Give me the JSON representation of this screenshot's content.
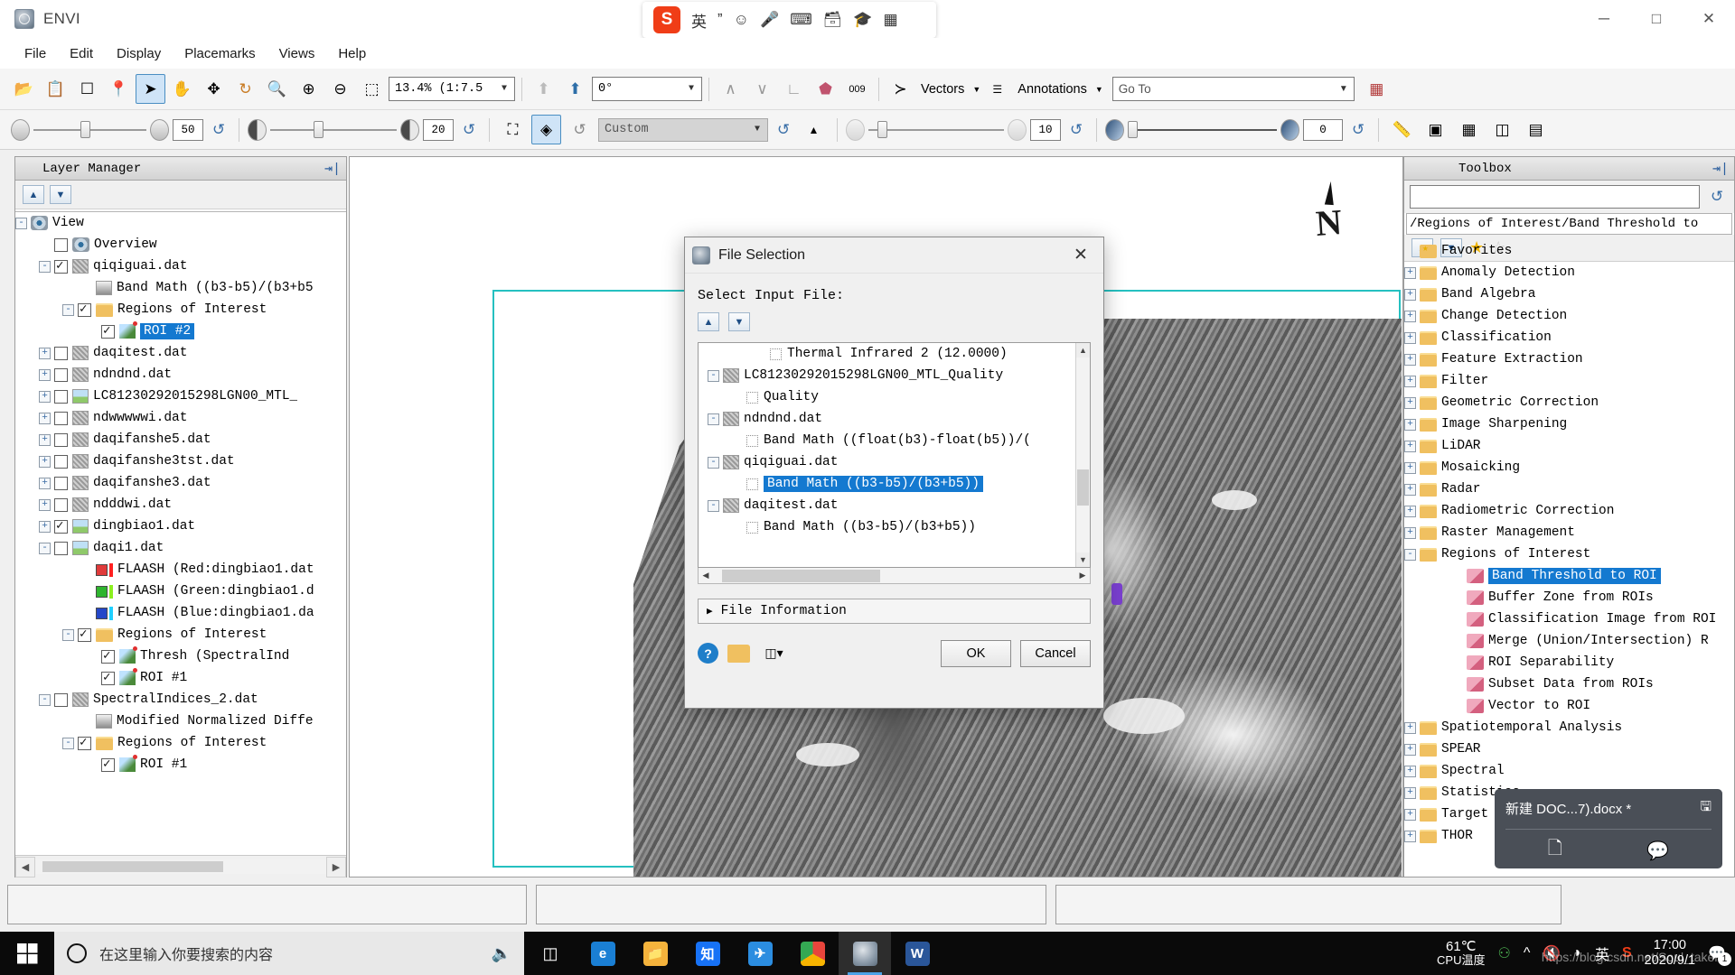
{
  "app": {
    "title": "ENVI",
    "icon": "envi-logo-icon"
  },
  "window_controls": {
    "minimize": "─",
    "maximize": "□",
    "close": "✕"
  },
  "ime": {
    "logo": "S",
    "items": [
      "英",
      "ˮ",
      "☺",
      "mic-icon",
      "keyboard-icon",
      "card-icon",
      "hat-icon",
      "grid-icon"
    ]
  },
  "menu": [
    "File",
    "Edit",
    "Display",
    "Placemarks",
    "Views",
    "Help"
  ],
  "toolbar1": {
    "buttons": [
      {
        "name": "open-file-icon",
        "glyph": "📂"
      },
      {
        "name": "clipboard-icon",
        "glyph": "📋"
      },
      {
        "name": "crop-icon",
        "glyph": "❐"
      },
      {
        "name": "placemark-pin-icon",
        "glyph": "📍"
      },
      {
        "name": "select-cursor-icon",
        "glyph": "➤"
      },
      {
        "name": "pan-hand-icon",
        "glyph": "✋"
      },
      {
        "name": "move-icon",
        "glyph": "✥"
      },
      {
        "name": "rotate-icon",
        "glyph": "↻"
      },
      {
        "name": "zoom-fit-icon",
        "glyph": "🔍"
      },
      {
        "name": "zoom-in-icon",
        "glyph": "⊕"
      },
      {
        "name": "zoom-out-icon",
        "glyph": "⊖"
      },
      {
        "name": "zoom-to-region-icon",
        "glyph": "⬚"
      }
    ],
    "zoom_value": "13.4% (1:7.5",
    "rotation_value": "0°",
    "arrow_up_icons": [
      "arrow-up-gray-icon",
      "arrow-up-north-icon"
    ],
    "extra_icons": [
      {
        "name": "spectral-profile-icon",
        "glyph": "ᴡ"
      },
      {
        "name": "spectral-library-icon",
        "glyph": "ᴡ"
      },
      {
        "name": "cursor-value-icon",
        "glyph": "∠"
      },
      {
        "name": "roi-tool-icon",
        "glyph": "⬟"
      },
      {
        "name": "pixel-locator-icon",
        "glyph": "009"
      }
    ],
    "vectors_label": "Vectors",
    "annotations_label": "Annotations",
    "goto_placeholder": "Go To",
    "goto_value": "Go To",
    "last_icon": "data-manager-icon"
  },
  "toolbar2": {
    "brightness_value": "50",
    "contrast_value": "20",
    "stretch_value": "Custom",
    "sharpen_value": "10",
    "transparency_value": "0",
    "fit_icons": [
      "fit-to-window-icon",
      "zoom-to-extent-icon"
    ]
  },
  "layer_manager": {
    "title": "Layer Manager",
    "pin_icon": "pin-panel-icon",
    "tools": [
      "move-layer-up-icon",
      "move-layer-down-icon"
    ],
    "tree": [
      {
        "indent": 0,
        "expander": "-",
        "checkbox": "none",
        "icon": "eye",
        "label": "View"
      },
      {
        "indent": 1,
        "expander": "none",
        "checkbox": "off",
        "icon": "eye",
        "label": "Overview"
      },
      {
        "indent": 1,
        "expander": "-",
        "checkbox": "on",
        "icon": "raster",
        "label": "qiqiguai.dat"
      },
      {
        "indent": 2,
        "expander": "none",
        "checkbox": "hidden",
        "icon": "band",
        "label": "Band Math ((b3-b5)/(b3+b5"
      },
      {
        "indent": 2,
        "expander": "-",
        "checkbox": "on",
        "icon": "folder",
        "label": "Regions of Interest"
      },
      {
        "indent": 3,
        "expander": "none",
        "checkbox": "on",
        "icon": "roi",
        "label": "ROI #2",
        "selected": true
      },
      {
        "indent": 1,
        "expander": "+",
        "checkbox": "off",
        "icon": "raster",
        "label": "daqitest.dat"
      },
      {
        "indent": 1,
        "expander": "+",
        "checkbox": "off",
        "icon": "raster",
        "label": "ndndnd.dat"
      },
      {
        "indent": 1,
        "expander": "+",
        "checkbox": "off",
        "icon": "img",
        "label": "LC81230292015298LGN00_MTL_"
      },
      {
        "indent": 1,
        "expander": "+",
        "checkbox": "off",
        "icon": "raster",
        "label": "ndwwwwwi.dat"
      },
      {
        "indent": 1,
        "expander": "+",
        "checkbox": "off",
        "icon": "raster",
        "label": "daqifanshe5.dat"
      },
      {
        "indent": 1,
        "expander": "+",
        "checkbox": "off",
        "icon": "raster",
        "label": "daqifanshe3tst.dat"
      },
      {
        "indent": 1,
        "expander": "+",
        "checkbox": "off",
        "icon": "raster",
        "label": "daqifanshe3.dat"
      },
      {
        "indent": 1,
        "expander": "+",
        "checkbox": "off",
        "icon": "raster",
        "label": "ndddwi.dat"
      },
      {
        "indent": 1,
        "expander": "+",
        "checkbox": "on",
        "icon": "img",
        "label": "dingbiao1.dat"
      },
      {
        "indent": 1,
        "expander": "-",
        "checkbox": "off",
        "icon": "img",
        "label": "daqi1.dat"
      },
      {
        "indent": 2,
        "expander": "none",
        "checkbox": "hidden",
        "icon": "swatch-red",
        "label": "FLAASH (Red:dingbiao1.dat"
      },
      {
        "indent": 2,
        "expander": "none",
        "checkbox": "hidden",
        "icon": "swatch-green",
        "label": "FLAASH (Green:dingbiao1.d"
      },
      {
        "indent": 2,
        "expander": "none",
        "checkbox": "hidden",
        "icon": "swatch-blue",
        "label": "FLAASH (Blue:dingbiao1.da"
      },
      {
        "indent": 2,
        "expander": "-",
        "checkbox": "on",
        "icon": "folder",
        "label": "Regions of Interest"
      },
      {
        "indent": 3,
        "expander": "none",
        "checkbox": "on",
        "icon": "roi",
        "label": "Thresh (SpectralInd"
      },
      {
        "indent": 3,
        "expander": "none",
        "checkbox": "on",
        "icon": "roi",
        "label": "ROI #1"
      },
      {
        "indent": 1,
        "expander": "-",
        "checkbox": "off",
        "icon": "raster",
        "label": "SpectralIndices_2.dat"
      },
      {
        "indent": 2,
        "expander": "none",
        "checkbox": "hidden",
        "icon": "band",
        "label": "Modified Normalized Diffe"
      },
      {
        "indent": 2,
        "expander": "-",
        "checkbox": "on",
        "icon": "folder",
        "label": "Regions of Interest"
      },
      {
        "indent": 3,
        "expander": "none",
        "checkbox": "on",
        "icon": "roi",
        "label": "ROI #1"
      }
    ]
  },
  "toolbox": {
    "title": "Toolbox",
    "pin_icon": "pin-panel-icon",
    "search_value": "",
    "refresh_icon": "refresh-icon",
    "path": "/Regions of Interest/Band Threshold to",
    "tools": [
      "move-up-icon",
      "move-down-icon",
      "add-favorite-star-icon",
      "remove-favorite-star-icon"
    ],
    "tree": [
      {
        "indent": 0,
        "expander": "none",
        "icon": "fav",
        "label": "Favorites"
      },
      {
        "indent": 0,
        "expander": "+",
        "icon": "folder",
        "label": "Anomaly Detection"
      },
      {
        "indent": 0,
        "expander": "+",
        "icon": "folder",
        "label": "Band Algebra"
      },
      {
        "indent": 0,
        "expander": "+",
        "icon": "folder",
        "label": "Change Detection"
      },
      {
        "indent": 0,
        "expander": "+",
        "icon": "folder",
        "label": "Classification"
      },
      {
        "indent": 0,
        "expander": "+",
        "icon": "folder",
        "label": "Feature Extraction"
      },
      {
        "indent": 0,
        "expander": "+",
        "icon": "folder",
        "label": "Filter"
      },
      {
        "indent": 0,
        "expander": "+",
        "icon": "folder",
        "label": "Geometric Correction"
      },
      {
        "indent": 0,
        "expander": "+",
        "icon": "folder",
        "label": "Image Sharpening"
      },
      {
        "indent": 0,
        "expander": "+",
        "icon": "folder",
        "label": "LiDAR"
      },
      {
        "indent": 0,
        "expander": "+",
        "icon": "folder",
        "label": "Mosaicking"
      },
      {
        "indent": 0,
        "expander": "+",
        "icon": "folder",
        "label": "Radar"
      },
      {
        "indent": 0,
        "expander": "+",
        "icon": "folder",
        "label": "Radiometric Correction"
      },
      {
        "indent": 0,
        "expander": "+",
        "icon": "folder",
        "label": "Raster Management"
      },
      {
        "indent": 0,
        "expander": "-",
        "icon": "folder",
        "label": "Regions of Interest"
      },
      {
        "indent": 1,
        "expander": "none",
        "icon": "roitool",
        "label": "Band Threshold to ROI",
        "selected": true
      },
      {
        "indent": 1,
        "expander": "none",
        "icon": "roitool",
        "label": "Buffer Zone from ROIs"
      },
      {
        "indent": 1,
        "expander": "none",
        "icon": "roitool",
        "label": "Classification Image from ROI"
      },
      {
        "indent": 1,
        "expander": "none",
        "icon": "roitool",
        "label": "Merge (Union/Intersection) R"
      },
      {
        "indent": 1,
        "expander": "none",
        "icon": "roitool",
        "label": "ROI Separability"
      },
      {
        "indent": 1,
        "expander": "none",
        "icon": "roitool",
        "label": "Subset Data from ROIs"
      },
      {
        "indent": 1,
        "expander": "none",
        "icon": "roitool",
        "label": "Vector to ROI"
      },
      {
        "indent": 0,
        "expander": "+",
        "icon": "folder",
        "label": "Spatiotemporal Analysis"
      },
      {
        "indent": 0,
        "expander": "+",
        "icon": "folder",
        "label": "SPEAR"
      },
      {
        "indent": 0,
        "expander": "+",
        "icon": "folder",
        "label": "Spectral"
      },
      {
        "indent": 0,
        "expander": "+",
        "icon": "folder",
        "label": "Statistics"
      },
      {
        "indent": 0,
        "expander": "+",
        "icon": "folder",
        "label": "Target Detection"
      },
      {
        "indent": 0,
        "expander": "+",
        "icon": "folder",
        "label": "THOR"
      }
    ]
  },
  "dialog": {
    "title": "File Selection",
    "icon": "envi-logo-icon",
    "close_icon": "close-icon",
    "subtitle": "Select Input File:",
    "nav_buttons": [
      "move-up-icon",
      "move-down-icon"
    ],
    "list": [
      {
        "indent": 2,
        "expander": "none",
        "label": "Thermal Infrared 2 (12.0000)"
      },
      {
        "indent": 0,
        "expander": "-",
        "icon": "raster",
        "label": "LC81230292015298LGN00_MTL_Quality"
      },
      {
        "indent": 1,
        "expander": "none",
        "label": "Quality"
      },
      {
        "indent": 0,
        "expander": "-",
        "icon": "raster",
        "label": "ndndnd.dat"
      },
      {
        "indent": 1,
        "expander": "none",
        "label": "Band Math ((float(b3)-float(b5))/("
      },
      {
        "indent": 0,
        "expander": "-",
        "icon": "raster",
        "label": "qiqiguai.dat"
      },
      {
        "indent": 1,
        "expander": "none",
        "label": "Band Math ((b3-b5)/(b3+b5))",
        "selected": true
      },
      {
        "indent": 0,
        "expander": "-",
        "icon": "raster",
        "label": "daqitest.dat"
      },
      {
        "indent": 1,
        "expander": "none",
        "label": "Band Math ((b3-b5)/(b3+b5))"
      }
    ],
    "file_information": "File Information",
    "file_information_expander": "▶",
    "help_icon": "help-icon",
    "open_icon": "open-folder-icon",
    "filter_icon": "filter-icon",
    "ok_label": "OK",
    "cancel_label": "Cancel"
  },
  "view": {
    "north_label": "N",
    "north_icon": "north-arrow-icon"
  },
  "toast": {
    "document": "新建 DOC...7).docx *",
    "save_icon": "save-document-icon",
    "new_icon": "new-document-icon",
    "share_icon": "share-icon",
    "close_icon": "close-icon"
  },
  "taskbar": {
    "start_icon": "windows-start-icon",
    "cortana_icon": "cortana-circle-icon",
    "search_placeholder": "在这里输入你要搜索的内容",
    "mic_icon": "microphone-icon",
    "task_view_icon": "task-view-icon",
    "apps": [
      {
        "name": "edge-icon",
        "glyph": "e",
        "color": "#1a7fd4"
      },
      {
        "name": "file-explorer-icon",
        "glyph": "📁",
        "color": "#f5b33c"
      },
      {
        "name": "zhihu-icon",
        "glyph": "知",
        "color": "#1772f6"
      },
      {
        "name": "foxmail-icon",
        "glyph": "✉",
        "color": "#2b8de0"
      },
      {
        "name": "chrome-icon",
        "glyph": "●",
        "color": "#e8453c"
      },
      {
        "name": "envi-taskbar-icon",
        "glyph": "◉",
        "color": "#7a8b99",
        "active": true
      },
      {
        "name": "word-icon",
        "glyph": "W",
        "color": "#2a5699"
      }
    ],
    "tray": {
      "cpu_temp": "61℃",
      "cpu_label": "CPU温度",
      "usb_icon": "usb-drive-icon",
      "chevron_icon": "show-hidden-icons-icon",
      "volume_icon": "volume-muted-icon",
      "network_icon": "wifi-icon",
      "ime_icon": "英",
      "sogou_icon": "sogou-icon",
      "time": "17:00",
      "date": "2020/9/1",
      "action_center_icon": "action-center-icon",
      "notification_count": "1"
    },
    "watermark": "https://blog.csdn.net/Soul_taker"
  }
}
